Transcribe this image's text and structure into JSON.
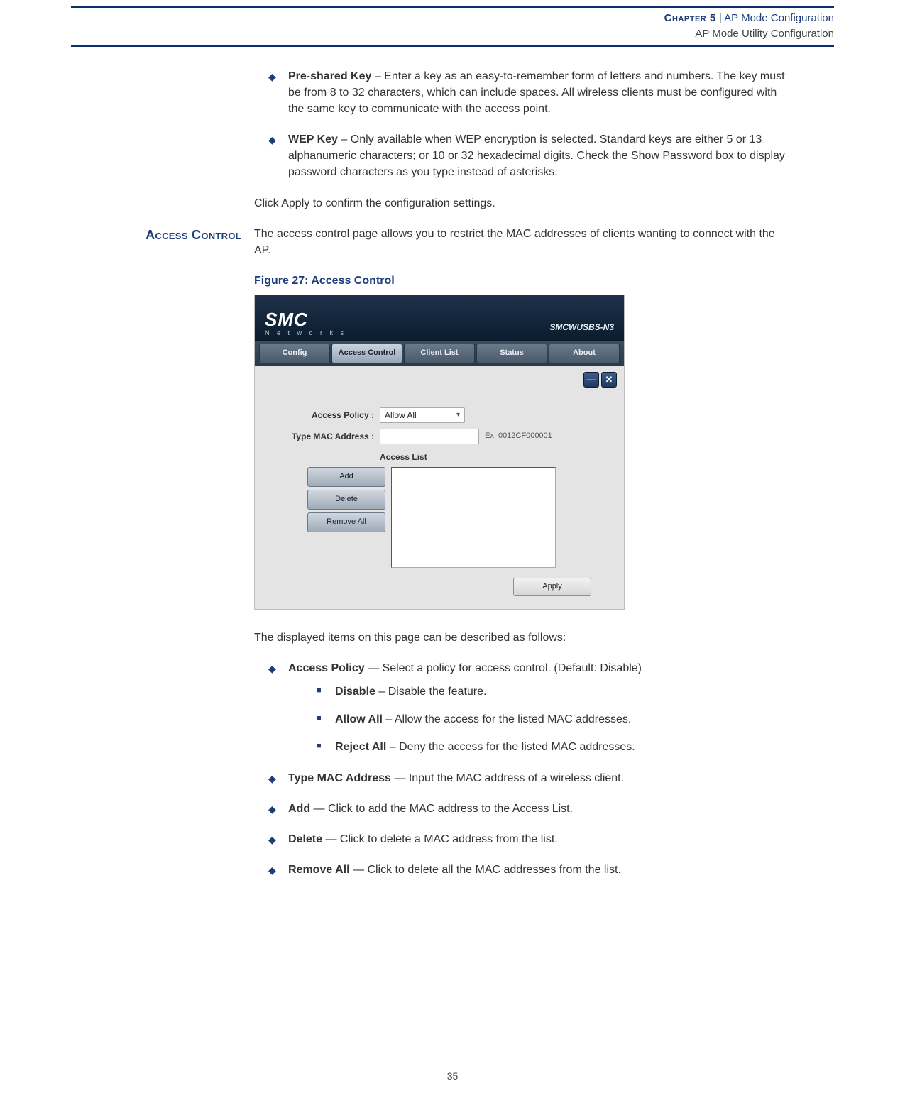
{
  "header": {
    "chapter": "Chapter 5",
    "separator": "|",
    "title": "AP Mode Configuration",
    "subtitle": "AP Mode Utility Configuration"
  },
  "preItems": [
    {
      "term": "Pre-shared Key",
      "desc": " – Enter a key as an easy-to-remember form of letters and numbers. The key must be from 8 to 32 characters, which can include spaces. All wireless clients must be configured with the same key to communicate with the access point."
    },
    {
      "term": "WEP Key",
      "desc": " – Only available when WEP encryption is selected. Standard keys are either 5 or 13 alphanumeric characters; or 10 or 32 hexadecimal digits. Check the Show Password box to display password characters as you type instead of asterisks."
    }
  ],
  "applyLine": "Click Apply to confirm the configuration settings.",
  "sectionLabel": "Access Control",
  "sectionIntro": "The access control page allows you to restrict the MAC addresses of clients wanting to connect with the AP.",
  "figureTitle": "Figure 27:  Access Control",
  "screenshot": {
    "brandBig": "SMC",
    "brandSmall": "N e t w o r k s",
    "model": "SMCWUSBS-N3",
    "tabs": [
      "Config",
      "Access Control",
      "Client List",
      "Status",
      "About"
    ],
    "activeTabIndex": 1,
    "minimize": "—",
    "close": "✕",
    "labels": {
      "accessPolicy": "Access Policy :",
      "typeMac": "Type MAC Address :",
      "accessList": "Access List"
    },
    "accessPolicyValue": "Allow All",
    "macValue": "",
    "macHint": "Ex: 0012CF000001",
    "buttons": {
      "add": "Add",
      "delete": "Delete",
      "removeAll": "Remove All",
      "apply": "Apply"
    }
  },
  "afterFigure": "The displayed items on this page can be described as follows:",
  "descItems": [
    {
      "term": "Access Policy",
      "desc": " — Select a policy for access control. (Default: Disable)",
      "sub": [
        {
          "term": "Disable",
          "desc": " – Disable the feature."
        },
        {
          "term": "Allow All",
          "desc": " – Allow the access for the listed MAC addresses."
        },
        {
          "term": "Reject All",
          "desc": " – Deny the access for the listed MAC addresses."
        }
      ]
    },
    {
      "term": "Type MAC Address",
      "desc": " — Input the MAC address of a wireless client."
    },
    {
      "term": "Add",
      "desc": " — Click to add the MAC address to the Access List."
    },
    {
      "term": "Delete",
      "desc": " — Click to delete a MAC address from the list."
    },
    {
      "term": "Remove All",
      "desc": " — Click to delete all the MAC addresses from the list."
    }
  ],
  "pageNumber": "–  35  –"
}
